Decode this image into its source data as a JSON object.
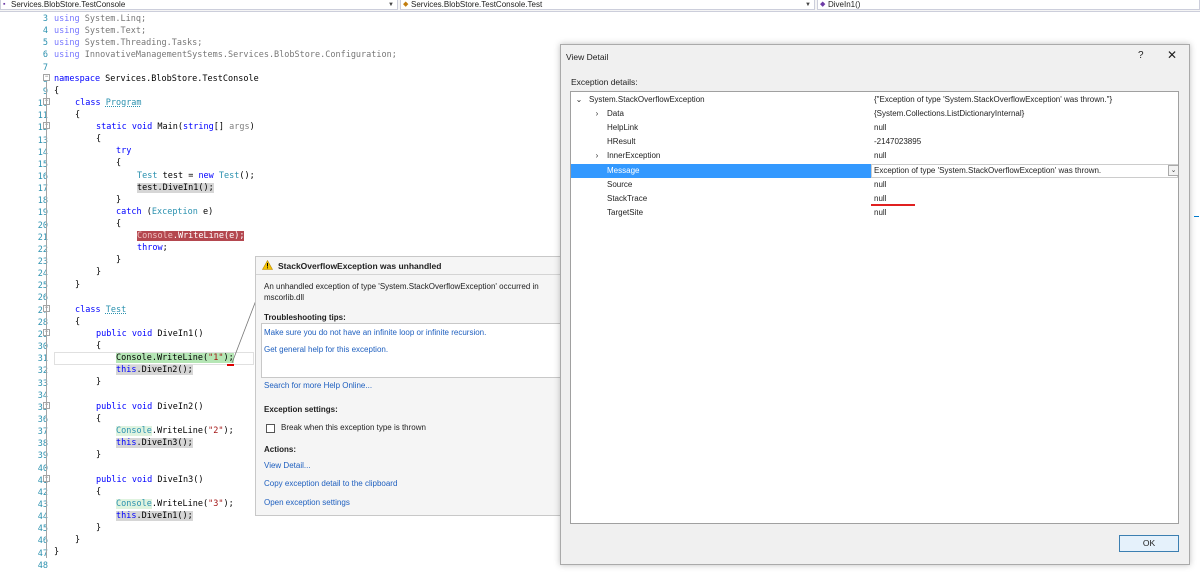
{
  "nav": {
    "project": "Services.BlobStore.TestConsole",
    "class": "Services.BlobStore.TestConsole.Test",
    "member": "DiveIn1()"
  },
  "editor": {
    "line_numbers": [
      "3",
      "4",
      "5",
      "6",
      "7",
      "8",
      "9",
      "10",
      "11",
      "12",
      "13",
      "14",
      "15",
      "16",
      "17",
      "18",
      "19",
      "20",
      "21",
      "22",
      "23",
      "24",
      "25",
      "26",
      "27",
      "28",
      "29",
      "30",
      "31",
      "32",
      "33",
      "34",
      "35",
      "36",
      "37",
      "38",
      "39",
      "40",
      "41",
      "42",
      "43",
      "44",
      "45",
      "46",
      "47",
      "48"
    ],
    "lines": {
      "l3": {
        "kw": "using",
        "rest": " System.Linq;"
      },
      "l4": {
        "kw": "using",
        "rest": " System.Text;"
      },
      "l5": {
        "kw": "using",
        "rest": " System.Threading.Tasks;"
      },
      "l6": {
        "kw": "using",
        "rest": " InnovativeManagementSystems.Services.BlobStore.Configuration;"
      },
      "l8": {
        "kw": "namespace",
        "rest": " Services.BlobStore.TestConsole"
      },
      "l9": "{",
      "l10": {
        "kw": "class",
        "ty": "Program"
      },
      "l11": "{",
      "l12": {
        "kw": "static void",
        "name": "Main",
        "p1": "(",
        "kw2": "string",
        "p2": "[] ",
        "arg": "args",
        "p3": ")"
      },
      "l13": "{",
      "l14": {
        "kw": "try"
      },
      "l15": "{",
      "l16": {
        "ty": "Test",
        "a": " test = ",
        "kw": "new",
        "ty2": "Test",
        "b": "();"
      },
      "l17": "test.DiveIn1();",
      "l18": "}",
      "l19": {
        "kw": "catch",
        "a": " (",
        "ty": "Exception",
        "b": " e)"
      },
      "l20": "{",
      "l21": {
        "ty": "Console",
        "rest": ".WriteLine(e);"
      },
      "l22": {
        "kw": "throw",
        "rest": ";"
      },
      "l23": "}",
      "l24": "}",
      "l25": "}",
      "l27": {
        "kw": "class",
        "ty": "Test"
      },
      "l28": "{",
      "l29": {
        "kw": "public void",
        "rest": " DiveIn1()"
      },
      "l30": "{",
      "l31": {
        "ty": "Console",
        "a": ".WriteLine(",
        "st": "\"1\"",
        "b": ");"
      },
      "l32": {
        "kw": "this",
        "rest": ".DiveIn2();"
      },
      "l33": "}",
      "l35": {
        "kw": "public void",
        "rest": " DiveIn2()"
      },
      "l36": "{",
      "l37": {
        "ty": "Console",
        "a": ".WriteLine(",
        "st": "\"2\"",
        "b": ");"
      },
      "l38": {
        "kw": "this",
        "rest": ".DiveIn3();"
      },
      "l39": "}",
      "l41": {
        "kw": "public void",
        "rest": " DiveIn3()"
      },
      "l42": "{",
      "l43": {
        "ty": "Console",
        "a": ".WriteLine(",
        "st": "\"3\"",
        "b": ");"
      },
      "l44": {
        "kw": "this",
        "rest": ".DiveIn1();"
      },
      "l45": "}",
      "l46": "}",
      "l47": "}"
    }
  },
  "popup": {
    "title": "StackOverflowException was unhandled",
    "message": "An unhandled exception of type 'System.StackOverflowException' occurred in mscorlib.dll",
    "tips_header": "Troubleshooting tips:",
    "tip1": "Make sure you do not have an infinite loop or infinite recursion.",
    "tip2": "Get general help for this exception.",
    "search_link": "Search for more Help Online...",
    "settings_header": "Exception settings:",
    "checkbox_label": "Break when this exception type is thrown",
    "actions_header": "Actions:",
    "action1": "View Detail...",
    "action2": "Copy exception detail to the clipboard",
    "action3": "Open exception settings"
  },
  "dialog": {
    "title": "View Detail",
    "help": "?",
    "close": "✕",
    "caption": "Exception details:",
    "rows": [
      {
        "name": "System.StackOverflowException",
        "value": "{\"Exception of type 'System.StackOverflowException' was thrown.\"}",
        "expander": "⌄"
      },
      {
        "name": "Data",
        "value": "{System.Collections.ListDictionaryInternal}",
        "expander": "›"
      },
      {
        "name": "HelpLink",
        "value": "null",
        "expander": ""
      },
      {
        "name": "HResult",
        "value": "-2147023895",
        "expander": ""
      },
      {
        "name": "InnerException",
        "value": "null",
        "expander": "›"
      },
      {
        "name": "Message",
        "value": "Exception of type 'System.StackOverflowException' was thrown.",
        "expander": ""
      },
      {
        "name": "Source",
        "value": "null",
        "expander": ""
      },
      {
        "name": "StackTrace",
        "value": "null",
        "expander": ""
      },
      {
        "name": "TargetSite",
        "value": "null",
        "expander": ""
      }
    ],
    "ok_label": "OK"
  },
  "colors": {
    "keyword": "#0000ff",
    "type": "#2b91af",
    "string": "#a31515",
    "selection": "#3399ff",
    "link": "#1e5fbf"
  }
}
